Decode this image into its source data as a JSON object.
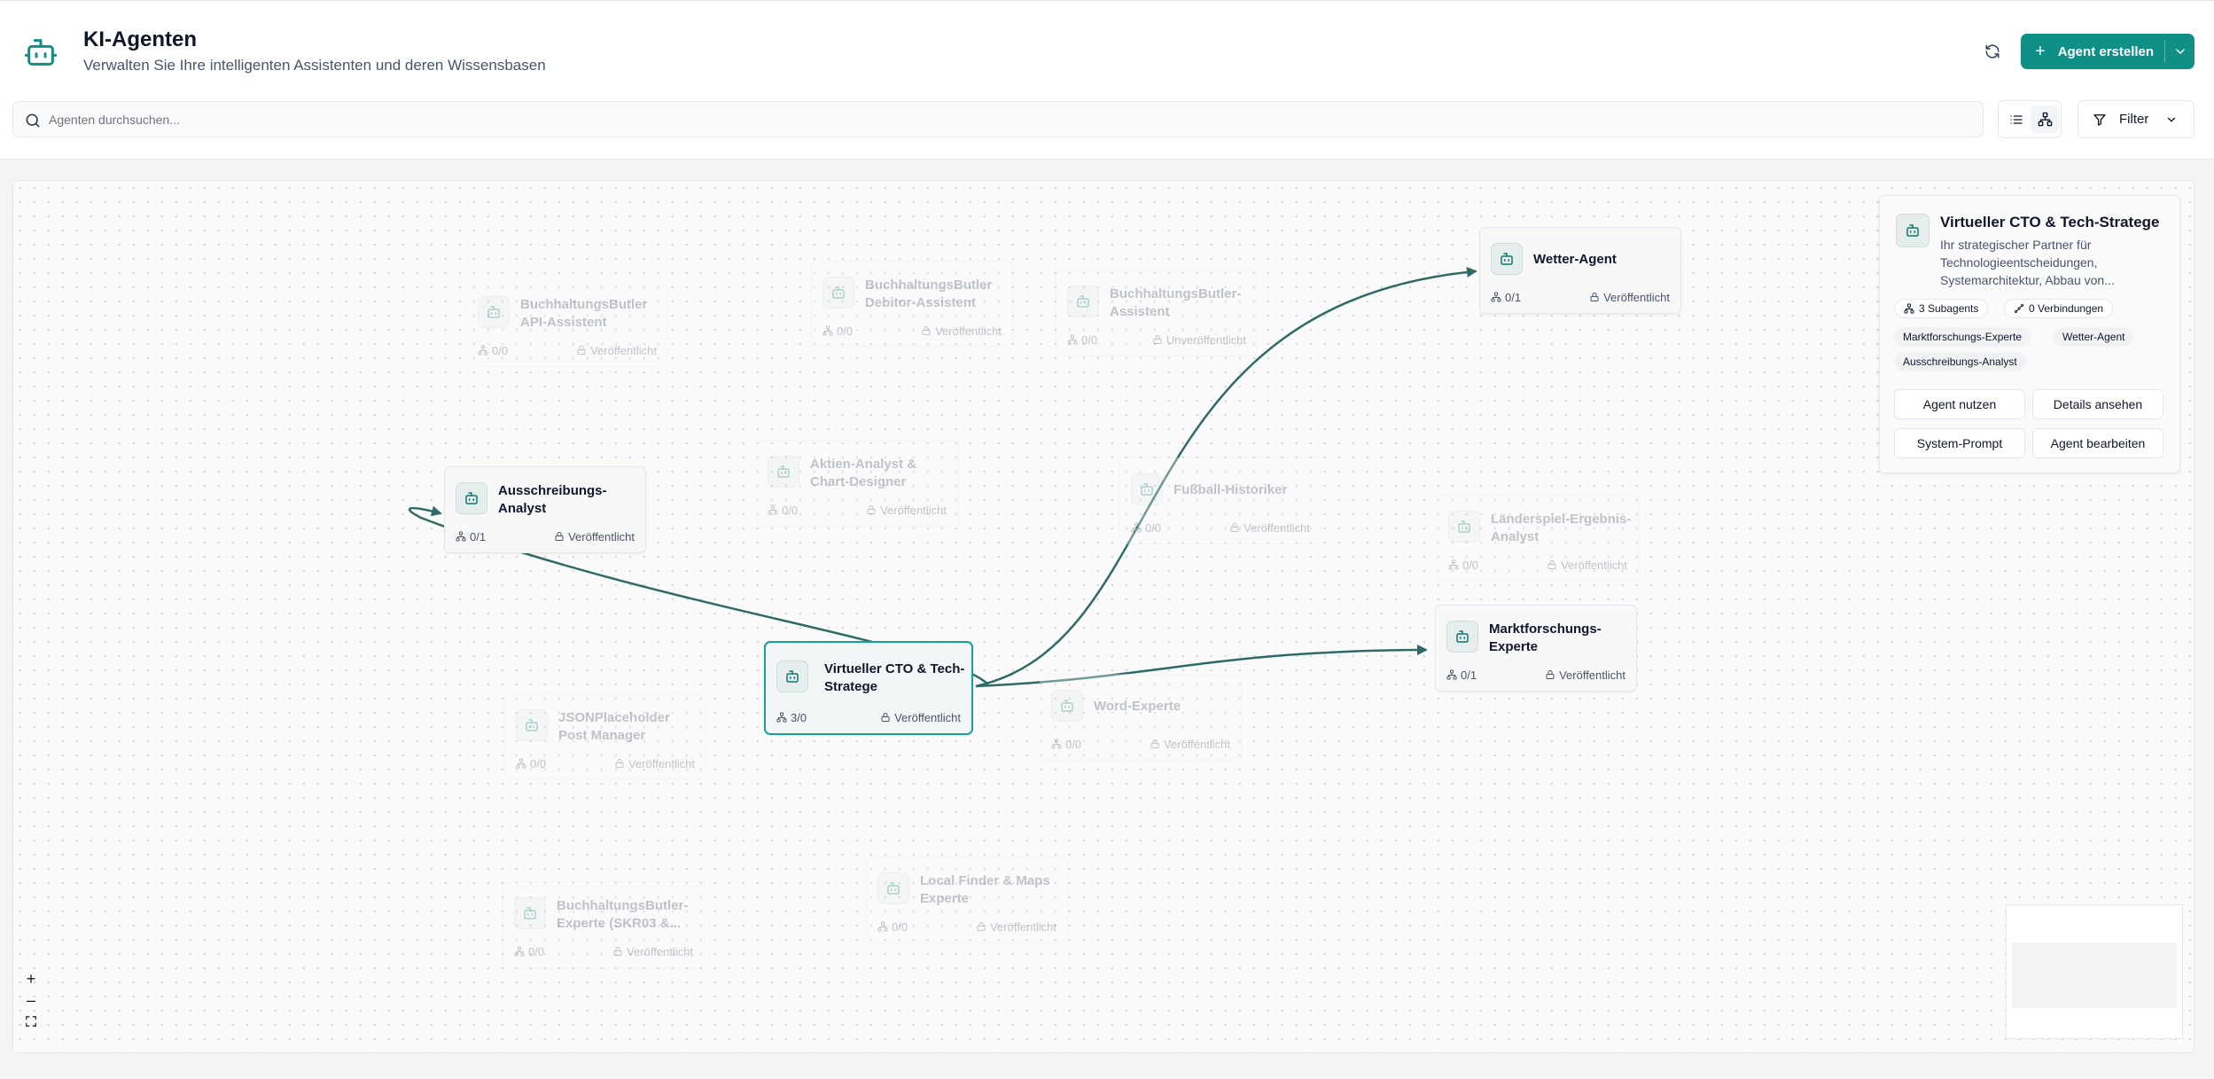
{
  "header": {
    "title": "KI-Agenten",
    "subtitle": "Verwalten Sie Ihre intelligenten Assistenten und deren Wissensbasen",
    "logo_icon": "robot-icon",
    "refresh_icon": "refresh-icon",
    "create_button_label": "Agent erstellen"
  },
  "toolbar": {
    "search_placeholder": "Agenten durchsuchen...",
    "view_list_icon": "list-icon",
    "view_graph_icon": "network-icon",
    "filter_label": "Filter"
  },
  "colors": {
    "accent": "#0f8f86",
    "selected_border": "#14a39a",
    "edge": "#2f6b66"
  },
  "nodes": {
    "n1": {
      "name": "BuchhaltungsButler API-Assistent",
      "stats": "0/0",
      "status": "Veröffentlicht"
    },
    "n2": {
      "name": "BuchhaltungsButler Debitor-Assistent",
      "stats": "0/0",
      "status": "Veröffentlicht"
    },
    "n3": {
      "name": "BuchhaltungsButler-Assistent",
      "stats": "0/0",
      "status": "Unveröffentlicht"
    },
    "n4": {
      "name": "Wetter-Agent",
      "stats": "0/1",
      "status": "Veröffentlicht"
    },
    "n5": {
      "name": "Ausschreibungs-Analyst",
      "stats": "0/1",
      "status": "Veröffentlicht"
    },
    "n6": {
      "name": "Aktien-Analyst & Chart-Designer",
      "stats": "0/0",
      "status": "Veröffentlicht"
    },
    "n7": {
      "name": "Fußball-Historiker",
      "stats": "0/0",
      "status": "Veröffentlicht"
    },
    "n8": {
      "name": "Länderspiel-Ergebnis-Analyst",
      "stats": "0/0",
      "status": "Veröffentlicht"
    },
    "n9": {
      "name": "Marktforschungs-Experte",
      "stats": "0/1",
      "status": "Veröffentlicht"
    },
    "n10": {
      "name": "Virtueller CTO & Tech-Stratege",
      "stats": "3/0",
      "status": "Veröffentlicht"
    },
    "n11": {
      "name": "Word-Experte",
      "stats": "0/0",
      "status": "Veröffentlicht"
    },
    "n12": {
      "name": "JSONPlaceholder Post Manager",
      "stats": "0/0",
      "status": "Veröffentlicht"
    },
    "n13": {
      "name": "BuchhaltungsButler-Experte (SKR03 &...",
      "stats": "0/0",
      "status": "Veröffentlicht"
    },
    "n14": {
      "name": "Local Finder & Maps Experte",
      "stats": "0/0",
      "status": "Veröffentlicht"
    }
  },
  "panel": {
    "title": "Virtueller CTO & Tech-Stratege",
    "description": "Ihr strategischer Partner für Technologieentscheidungen, Systemarchitektur, Abbau von...",
    "subagents_label": "3 Subagents",
    "connections_label": "0 Verbindungen",
    "tags": [
      "Marktforschungs-Experte",
      "Wetter-Agent",
      "Ausschreibungs-Analyst"
    ],
    "buttons": {
      "use": "Agent nutzen",
      "details": "Details ansehen",
      "system_prompt": "System-Prompt",
      "edit": "Agent bearbeiten"
    }
  },
  "zoom_controls": {
    "zoom_in": "+",
    "zoom_out": "–"
  }
}
